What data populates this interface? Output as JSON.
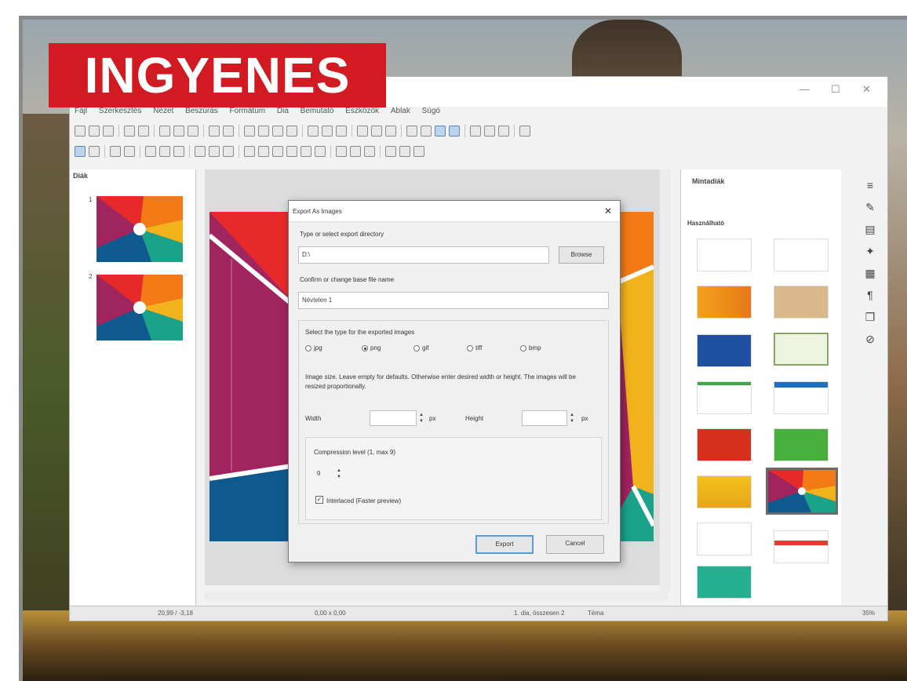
{
  "badge": {
    "text": "INGYENES"
  },
  "app": {
    "menu": [
      "Fájl",
      "Szerkesztés",
      "Nézet",
      "Beszúrás",
      "Formátum",
      "Dia",
      "Bemutató",
      "Eszközök",
      "Ablak",
      "Súgó"
    ],
    "slides_panel": {
      "title": "Diák",
      "numbers": [
        "1",
        "2"
      ]
    },
    "sidebar": {
      "title": "Mintadiák",
      "section": "Használható"
    },
    "statusbar": {
      "position": "20,99 / -3,18",
      "size": "0,00 x 0,00",
      "slide": "1. dia, összesen 2",
      "layout": "Téma",
      "zoom": "35%"
    }
  },
  "dialog": {
    "title": "Export As Images",
    "close_icon": "close-icon",
    "dir_label": "Type or select export directory",
    "dir_value": "D:\\",
    "browse_label": "Browse",
    "name_label": "Confirm or change base file name",
    "name_value": "Névtelen 1",
    "type_label": "Select the type for the exported images",
    "types": [
      "jpg",
      "png",
      "gif",
      "tiff",
      "bmp"
    ],
    "selected_type": "png",
    "size_note": "Image size. Leave empty for defaults. Otherwise enter desired width or height. The images will be resized proportionally.",
    "width_label": "Width",
    "width_unit": "px",
    "height_label": "Height",
    "height_unit": "px",
    "compression_label": "Compression level (1, max 9)",
    "compression_value": "9",
    "interlaced_label": "Interlaced (Faster preview)",
    "interlaced_checked": true,
    "export_label": "Export",
    "cancel_label": "Cancel"
  },
  "colors": {
    "badge": "#d11a21",
    "slide_red": "#e62a2a",
    "slide_purple": "#a0245e",
    "slide_blue": "#0e5a8e",
    "slide_orange": "#f47a16",
    "slide_yellow": "#f2b21b",
    "slide_teal": "#1aa38a",
    "slide_green": "#2fa550"
  }
}
